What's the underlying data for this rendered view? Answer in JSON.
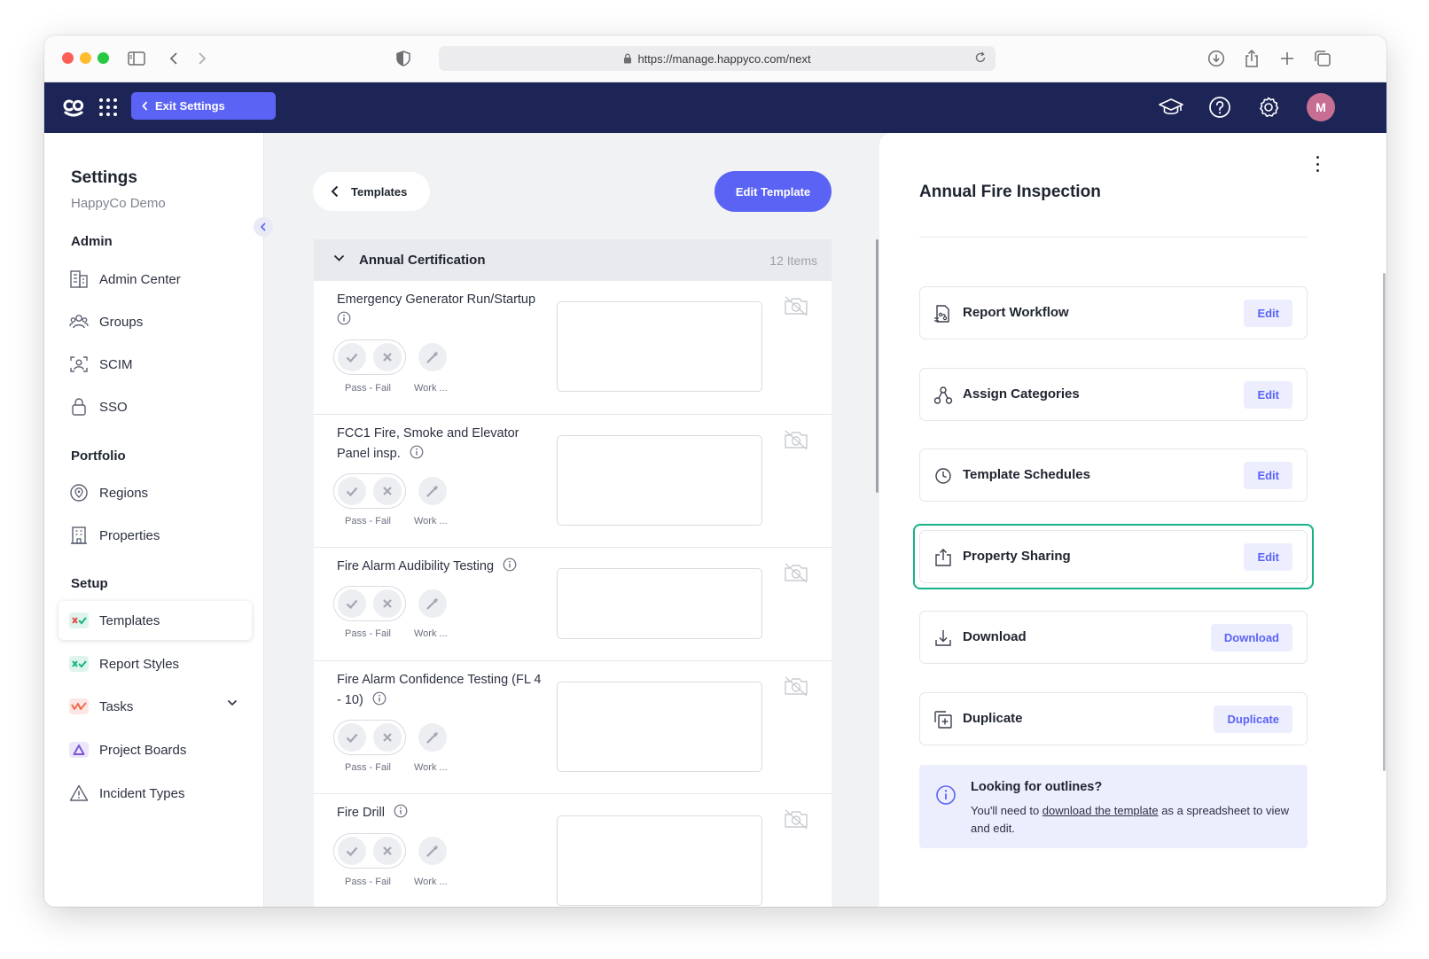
{
  "browser": {
    "url": "https://manage.happyco.com/next"
  },
  "topnav": {
    "exit_label": "Exit Settings",
    "avatar_initial": "M",
    "icons": [
      "graduation-cap-icon",
      "help-icon",
      "settings-icon"
    ]
  },
  "sidebar": {
    "title": "Settings",
    "subtitle": "HappyCo Demo",
    "sections": {
      "admin": "Admin",
      "portfolio": "Portfolio",
      "setup": "Setup"
    },
    "items": {
      "admin_center": "Admin Center",
      "groups": "Groups",
      "scim": "SCIM",
      "sso": "SSO",
      "regions": "Regions",
      "properties": "Properties",
      "templates": "Templates",
      "report_styles": "Report Styles",
      "tasks": "Tasks",
      "project_boards": "Project Boards",
      "incident_types": "Incident Types"
    },
    "active_item": "Templates"
  },
  "toolbar": {
    "back_label": "Templates",
    "edit_template_label": "Edit Template"
  },
  "section": {
    "title": "Annual Certification",
    "count": "12 Items"
  },
  "rows": [
    {
      "title": "Emergency Generator Run/Startup",
      "pass_fail": "Pass - Fail",
      "work": "Work ..."
    },
    {
      "title": "FCC1 Fire, Smoke and Elevator Panel insp.",
      "pass_fail": "Pass - Fail",
      "work": "Work ..."
    },
    {
      "title": "Fire Alarm Audibility Testing",
      "pass_fail": "Pass - Fail",
      "work": "Work ..."
    },
    {
      "title": "Fire Alarm Confidence Testing (FL 4 - 10)",
      "pass_fail": "Pass - Fail",
      "work": "Work ..."
    },
    {
      "title": "Fire Drill",
      "pass_fail": "Pass - Fail",
      "work": "Work ..."
    }
  ],
  "panel": {
    "title": "Annual Fire Inspection",
    "cards": [
      {
        "label": "Report Workflow",
        "button": "Edit",
        "icon": "report-workflow-icon"
      },
      {
        "label": "Assign Categories",
        "button": "Edit",
        "icon": "categories-icon"
      },
      {
        "label": "Template Schedules",
        "button": "Edit",
        "icon": "clock-icon"
      },
      {
        "label": "Property Sharing",
        "button": "Edit",
        "icon": "share-icon"
      },
      {
        "label": "Download",
        "button": "Download",
        "icon": "download-icon"
      },
      {
        "label": "Duplicate",
        "button": "Duplicate",
        "icon": "duplicate-icon"
      }
    ],
    "highlighted_card": "Property Sharing",
    "info": {
      "title": "Looking for outlines?",
      "text_before": "You'll need to ",
      "link": "download the template",
      "text_after": " as a spreadsheet to view and edit."
    }
  },
  "colors": {
    "nav_bg": "#1d2556",
    "accent": "#5b63f5",
    "highlight": "#16b287",
    "soft_accent": "#eceefe"
  }
}
